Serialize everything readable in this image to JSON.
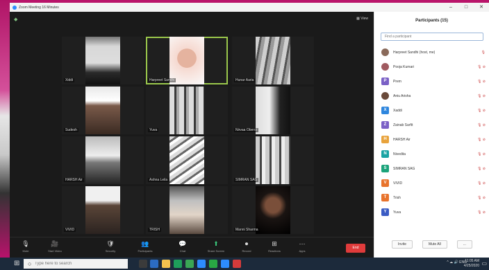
{
  "window_title": "Zoom Meeting 16 Minutes",
  "view_label": "View",
  "window_controls": [
    "–",
    "□",
    "✕"
  ],
  "tiles": [
    {
      "name": "Xiddi",
      "theme": "t1"
    },
    {
      "name": "Harpreet Sandhi",
      "theme": "t2",
      "active": true
    },
    {
      "name": "Hunar Aaria",
      "theme": "t3"
    },
    {
      "name": "Sudesh",
      "theme": "t4"
    },
    {
      "name": "Yuva",
      "theme": "t5"
    },
    {
      "name": "Nirvaa Oberoi",
      "theme": "t6"
    },
    {
      "name": "HARSH Air",
      "theme": "t7"
    },
    {
      "name": "Ashna Leila",
      "theme": "t8"
    },
    {
      "name": "SIMRAN SAG",
      "theme": "t9"
    },
    {
      "name": "VIVID",
      "theme": "t10"
    },
    {
      "name": "TRISH",
      "theme": "t11"
    },
    {
      "name": "Manni Sharma",
      "theme": "t12"
    }
  ],
  "toolbar": [
    {
      "icon": "🎙",
      "label": "Mute",
      "name": "mute"
    },
    {
      "icon": "🎥",
      "label": "Start Video",
      "name": "start-video"
    },
    {
      "icon": "🛡",
      "label": "Security",
      "name": "security"
    },
    {
      "icon": "👥",
      "label": "Participants",
      "name": "participants"
    },
    {
      "icon": "💬",
      "label": "Chat",
      "name": "chat"
    },
    {
      "icon": "⬆",
      "label": "Share Screen",
      "name": "share-screen",
      "green": true
    },
    {
      "icon": "⏺",
      "label": "Record",
      "name": "record"
    },
    {
      "icon": "⊞",
      "label": "Reactions",
      "name": "reactions"
    },
    {
      "icon": "⋯",
      "label": "Apps",
      "name": "apps"
    }
  ],
  "end_label": "End",
  "panel": {
    "title": "Participants (15)",
    "search_placeholder": "Find a participant",
    "participants": [
      {
        "name": "Harpreet Sandhi (host, me)",
        "initial": "",
        "color": "#8a6a5a",
        "photo": true
      },
      {
        "name": "Pooja Kumari",
        "initial": "",
        "color": "#a05a60",
        "photo": true
      },
      {
        "name": "Prem",
        "initial": "P",
        "color": "#7b61c6"
      },
      {
        "name": "Aniu Arisha",
        "initial": "",
        "color": "#6a4a3a",
        "photo": true
      },
      {
        "name": "Xaddi",
        "initial": "X",
        "color": "#2e86de"
      },
      {
        "name": "Zainab Sarfit",
        "initial": "Z",
        "color": "#7b61c6"
      },
      {
        "name": "HARSH Air",
        "initial": "H",
        "color": "#e8a33c"
      },
      {
        "name": "Nivedita",
        "initial": "N",
        "color": "#1aa3a3"
      },
      {
        "name": "SIMRAN SAG",
        "initial": "S",
        "color": "#1aa37a"
      },
      {
        "name": "VIVID",
        "initial": "V",
        "color": "#e8732c"
      },
      {
        "name": "Trish",
        "initial": "T",
        "color": "#e8732c"
      },
      {
        "name": "Yuva",
        "initial": "Y",
        "color": "#3b5cc4"
      }
    ],
    "footer": [
      "Invite",
      "Mute All",
      "..."
    ]
  },
  "taskbar": {
    "search": "Type here to search",
    "tray": "^ ☁ 🔊 ENG",
    "time": "11:05 AM",
    "date": "4/25/2020"
  }
}
